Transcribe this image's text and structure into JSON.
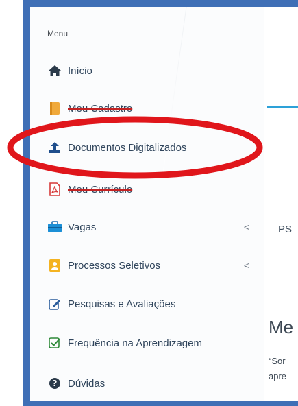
{
  "menu": {
    "heading": "Menu",
    "items": [
      {
        "label": "Início",
        "icon": "home-icon"
      },
      {
        "label": "Meu Cadastro",
        "icon": "notebook-icon"
      },
      {
        "label": "Documentos Digitalizados",
        "icon": "upload-icon"
      },
      {
        "label": "Meu Currículo",
        "icon": "pdf-file-icon"
      },
      {
        "label": "Vagas",
        "icon": "briefcase-icon",
        "chevron": "<"
      },
      {
        "label": "Processos Seletivos",
        "icon": "user-card-icon",
        "chevron": "<"
      },
      {
        "label": "Pesquisas e Avaliações",
        "icon": "edit-icon"
      },
      {
        "label": "Frequência na Aprendizagem",
        "icon": "check-square-icon"
      },
      {
        "label": "Dúvidas",
        "icon": "question-circle-icon"
      }
    ]
  },
  "content": {
    "ps": "PS",
    "title": "Me",
    "quote_line1": "“Sor",
    "quote_line2": "apre"
  },
  "colors": {
    "frame": "#3f6fb6",
    "highlight": "#e0161b",
    "tab_accent": "#2da1d8"
  }
}
